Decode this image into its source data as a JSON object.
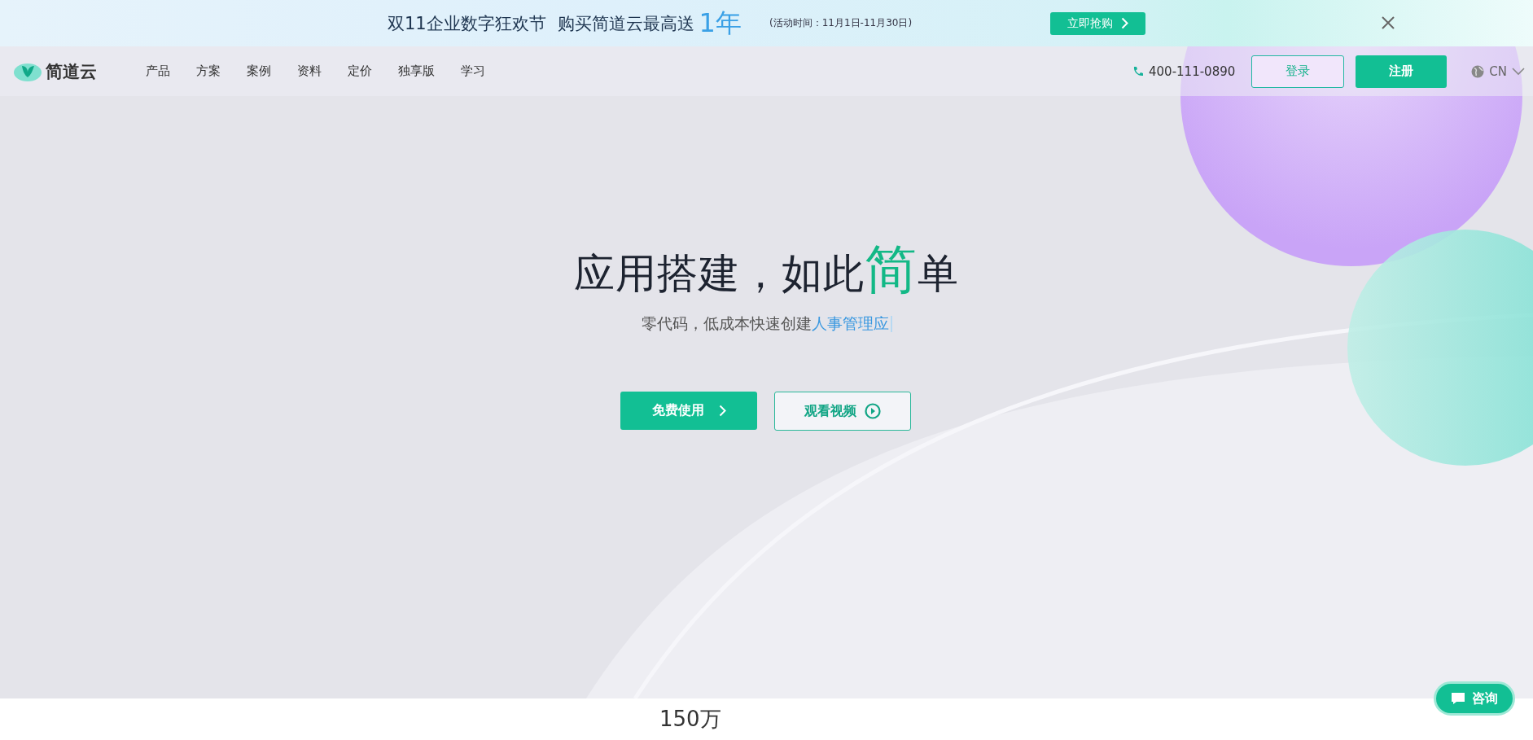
{
  "promo_banner": {
    "headline": "双11企业数字狂欢节",
    "offer": "购买简道云最高送",
    "highlight": "1年",
    "period": "(活动时间：11月1日-11月30日)",
    "button": "立即抢购"
  },
  "nav": {
    "logo": "简道云",
    "items": [
      "产品",
      "方案",
      "案例",
      "资料",
      "定价",
      "独享版",
      "学习"
    ],
    "phone": "400-111-0890",
    "login": "登录",
    "register": "注册",
    "language": "CN"
  },
  "hero": {
    "title_before": "应用搭建，如此",
    "title_accent": "简",
    "title_after": "单",
    "subtitle": "零代码，低成本快速创建",
    "typed": "人事管理应",
    "primary_button": "免费使用",
    "secondary_button": "观看视频"
  },
  "stat": "150万",
  "chat_button": "咨询"
}
